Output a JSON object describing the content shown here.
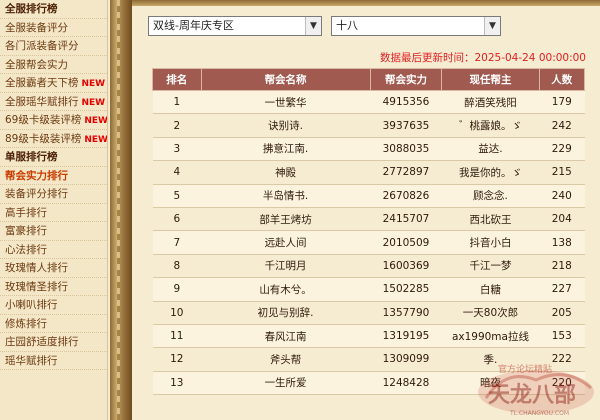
{
  "sidebar": {
    "items": [
      {
        "label": "全服排行榜",
        "type": "header",
        "new": false
      },
      {
        "label": "全服装备评分",
        "type": "link",
        "new": false
      },
      {
        "label": "各门派装备评分",
        "type": "link",
        "new": false
      },
      {
        "label": "全服帮会实力",
        "type": "link",
        "new": false
      },
      {
        "label": "全服霸者天下榜",
        "type": "link",
        "new": true
      },
      {
        "label": "全服瑶华赋排行",
        "type": "link",
        "new": true
      },
      {
        "label": "69级卡级装评榜",
        "type": "link",
        "new": true
      },
      {
        "label": "89级卡级装评榜",
        "type": "link",
        "new": true
      },
      {
        "label": "单服排行榜",
        "type": "header",
        "new": false
      },
      {
        "label": "帮会实力排行",
        "type": "active",
        "new": false
      },
      {
        "label": "装备评分排行",
        "type": "link",
        "new": false
      },
      {
        "label": "高手排行",
        "type": "link",
        "new": false
      },
      {
        "label": "富豪排行",
        "type": "link",
        "new": false
      },
      {
        "label": "心法排行",
        "type": "link",
        "new": false
      },
      {
        "label": "玫瑰情人排行",
        "type": "link",
        "new": false
      },
      {
        "label": "玫瑰情圣排行",
        "type": "link",
        "new": false
      },
      {
        "label": "小喇叭排行",
        "type": "link",
        "new": false
      },
      {
        "label": "修炼排行",
        "type": "link",
        "new": false
      },
      {
        "label": "庄园舒适度排行",
        "type": "link",
        "new": false
      },
      {
        "label": "瑶华赋排行",
        "type": "link",
        "new": false
      }
    ],
    "new_badge": "NEW"
  },
  "filters": {
    "server_group": "双线-周年庆专区",
    "server": "十八"
  },
  "update_notice": "数据最后更新时间：2025-04-24 00:00:00",
  "table": {
    "headers": [
      "排名",
      "帮会名称",
      "帮会实力",
      "现任帮主",
      "人数"
    ],
    "rows": [
      [
        "1",
        "一世繁华",
        "4915356",
        "醉酒笑残阳",
        "179"
      ],
      [
        "2",
        "诀别诗.",
        "3937635",
        "゛桃露娘。ゞ",
        "242"
      ],
      [
        "3",
        "拂意江南.",
        "3088035",
        "益达.",
        "229"
      ],
      [
        "4",
        "神殿",
        "2772897",
        "我是你的。ゞ",
        "215"
      ],
      [
        "5",
        "半岛情书.",
        "2670826",
        "顾念念.",
        "240"
      ],
      [
        "6",
        "部羊王烤坊",
        "2415707",
        "西北砍王",
        "204"
      ],
      [
        "7",
        "远赴人间",
        "2010509",
        "抖音小白",
        "138"
      ],
      [
        "8",
        "千江明月",
        "1600369",
        "千江一梦",
        "218"
      ],
      [
        "9",
        "山有木兮。",
        "1502285",
        "白糖",
        "227"
      ],
      [
        "10",
        "初见与别辞.",
        "1357790",
        "一天80次郎",
        "205"
      ],
      [
        "11",
        "春风江南",
        "1319195",
        "ax1990ma拉线",
        "153"
      ],
      [
        "12",
        "斧头帮",
        "1309099",
        "季.",
        "222"
      ],
      [
        "13",
        "一生所爱",
        "1248428",
        "暗夜",
        "220"
      ]
    ]
  },
  "watermark": {
    "text_top": "官方论坛精贴",
    "logo_text": "天龙八部",
    "url": "TL.CHANGYOU.COM"
  },
  "colors": {
    "header_bg": "#a05a50",
    "update_text": "#e02020",
    "new_badge": "#e60000",
    "sidebar_bg": "#f4e7c7",
    "page_bg": "#f6ecd2"
  }
}
